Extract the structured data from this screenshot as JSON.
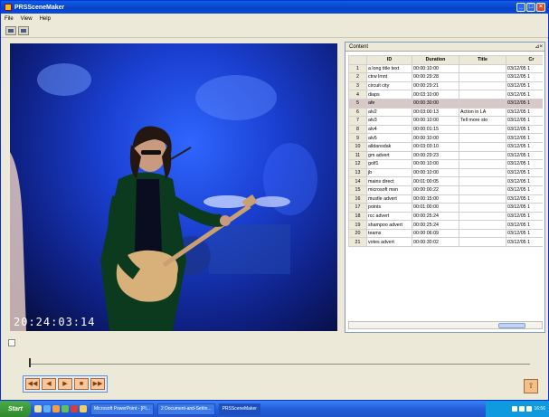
{
  "window": {
    "title": "PRSSceneMaker"
  },
  "menu": [
    "File",
    "View",
    "Help"
  ],
  "toolbar": {
    "icons": [
      "open-icon",
      "grid-icon"
    ]
  },
  "video": {
    "timecode": "20:24:03:14"
  },
  "panel": {
    "title": "Content",
    "pin_label": "⊿×",
    "columns": [
      "",
      "ID",
      "Duration",
      "Title",
      "Cr"
    ],
    "selected_row": 5,
    "rows": [
      {
        "n": "1",
        "id": "a long title text",
        "duration": "00:00:10:00",
        "title": "",
        "cr": "03/12/05 1"
      },
      {
        "n": "2",
        "id": "ctrw lmnt",
        "duration": "00:00:29:28",
        "title": "",
        "cr": "03/12/05 1"
      },
      {
        "n": "3",
        "id": "circuit city",
        "duration": "00:00:29:21",
        "title": "",
        "cr": "03/12/05 1"
      },
      {
        "n": "4",
        "id": "diaps",
        "duration": "00:03:10:00",
        "title": "",
        "cr": "03/12/05 1"
      },
      {
        "n": "5",
        "id": "afe",
        "duration": "00:00:30:00",
        "title": "",
        "cr": "03/12/05 1"
      },
      {
        "n": "6",
        "id": "alv2",
        "duration": "00:03:00:13",
        "title": "Action in LA",
        "cr": "03/12/05 1"
      },
      {
        "n": "7",
        "id": "alv3",
        "duration": "00:00:10:00",
        "title": "Tell more sto",
        "cr": "03/12/05 1"
      },
      {
        "n": "8",
        "id": "alv4",
        "duration": "00:00:01:15",
        "title": "",
        "cr": "03/12/05 1"
      },
      {
        "n": "9",
        "id": "alv5",
        "duration": "00:00:10:00",
        "title": "",
        "cr": "03/12/05 1"
      },
      {
        "n": "10",
        "id": "alldansdak",
        "duration": "00:03:03:10",
        "title": "",
        "cr": "03/12/05 1"
      },
      {
        "n": "11",
        "id": "gm advert",
        "duration": "00:00:29:23",
        "title": "",
        "cr": "03/12/05 1"
      },
      {
        "n": "12",
        "id": "golf1",
        "duration": "00:00:10:00",
        "title": "",
        "cr": "03/12/05 1"
      },
      {
        "n": "13",
        "id": "jb",
        "duration": "00:00:10:00",
        "title": "",
        "cr": "03/12/05 1"
      },
      {
        "n": "14",
        "id": "mains direct",
        "duration": "00:01:00:05",
        "title": "",
        "cr": "03/12/05 1"
      },
      {
        "n": "15",
        "id": "microsoft msn",
        "duration": "00:00:00:22",
        "title": "",
        "cr": "03/12/05 1"
      },
      {
        "n": "16",
        "id": "mustle advert",
        "duration": "00:00:15:00",
        "title": "",
        "cr": "03/12/05 1"
      },
      {
        "n": "17",
        "id": "points",
        "duration": "00:01:00:00",
        "title": "",
        "cr": "03/12/05 1"
      },
      {
        "n": "18",
        "id": "rcc advert",
        "duration": "00:00:25:24",
        "title": "",
        "cr": "03/12/05 1"
      },
      {
        "n": "19",
        "id": "shampoo advert",
        "duration": "00:00:25:24",
        "title": "",
        "cr": "03/12/05 1"
      },
      {
        "n": "20",
        "id": "teams",
        "duration": "00:00:06:09",
        "title": "",
        "cr": "03/12/05 1"
      },
      {
        "n": "21",
        "id": "votes advert",
        "duration": "00:00:30:02",
        "title": "",
        "cr": "03/12/05 1"
      }
    ]
  },
  "controls": {
    "buttons": [
      {
        "name": "rewind-button",
        "icon": "rewind-icon",
        "glyph": "◀◀"
      },
      {
        "name": "prev-frame-button",
        "icon": "prev-frame-icon",
        "glyph": "◀"
      },
      {
        "name": "play-button",
        "icon": "play-icon",
        "glyph": "▶"
      },
      {
        "name": "stop-button",
        "icon": "stop-icon",
        "glyph": "■"
      },
      {
        "name": "fast-forward-button",
        "icon": "fast-forward-icon",
        "glyph": "▶▶"
      }
    ],
    "side_button_glyph": "⇧"
  },
  "taskbar": {
    "start": "Start",
    "tasks": [
      {
        "label": "Microsoft PowerPoint - [PI...",
        "active": false
      },
      {
        "label": "2 Document-and-Settin...",
        "active": false
      },
      {
        "label": "PRSSceneMaker",
        "active": true
      }
    ],
    "clock": "16:56"
  },
  "colors": {
    "title_bar": "#0a5fe6",
    "taskbar": "#245edb",
    "start": "#3c9a3a",
    "video_bg": "#1a3fd0"
  }
}
